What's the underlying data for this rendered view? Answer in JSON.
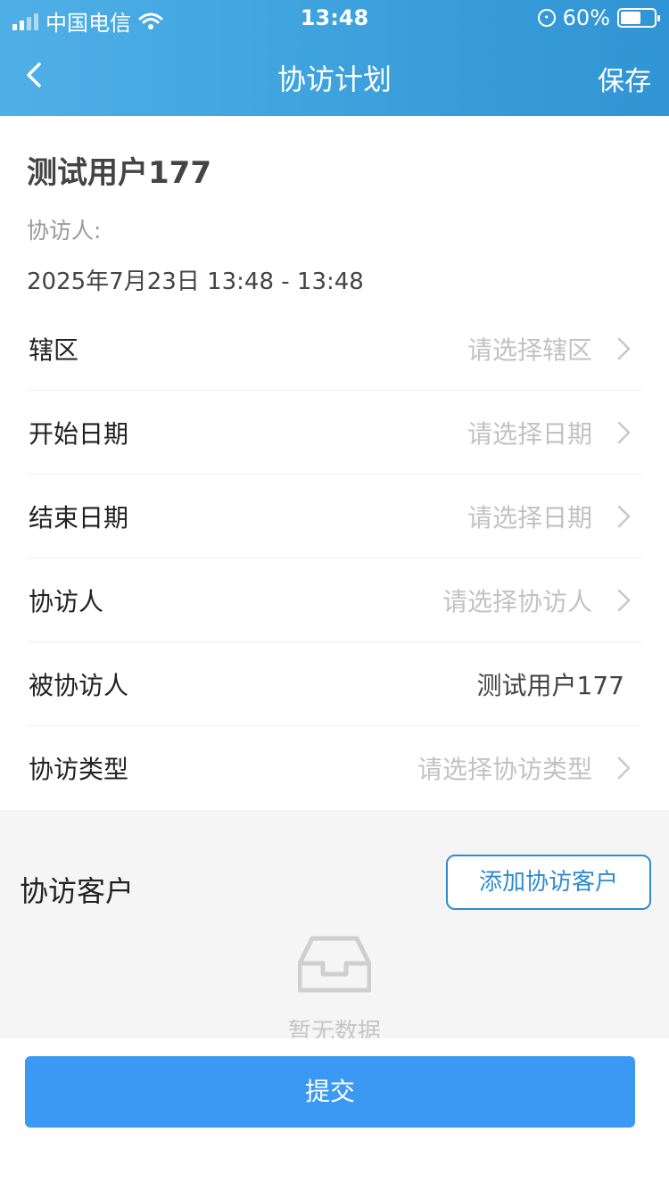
{
  "status_bar": {
    "carrier": "中国电信",
    "time": "13:48",
    "battery": "60%",
    "battery_level": 0.6
  },
  "nav": {
    "title": "协访计划",
    "save_label": "保存",
    "back_icon": "chevron-left-icon"
  },
  "profile": {
    "user_name": "测试用户177",
    "escort_label": "协访人:",
    "time_range": "2025年7月23日 13:48 - 13:48"
  },
  "form": {
    "rows": [
      {
        "label": "辖区",
        "value": "请选择辖区",
        "placeholder": true
      },
      {
        "label": "开始日期",
        "value": "请选择日期",
        "placeholder": true
      },
      {
        "label": "结束日期",
        "value": "请选择日期",
        "placeholder": true
      },
      {
        "label": "协访人",
        "value": "请选择协访人",
        "placeholder": true
      },
      {
        "label": "被协访人",
        "value": "测试用户177",
        "placeholder": false
      },
      {
        "label": "协访类型",
        "value": "请选择协访类型",
        "placeholder": true
      }
    ]
  },
  "customers": {
    "title": "协访客户",
    "add_label": "添加协访客户",
    "empty_text": "暂无数据",
    "empty_icon": "inbox-icon"
  },
  "submit_label": "提交",
  "colors": {
    "header_gradient_start": "#4fb0e6",
    "header_gradient_end": "#3194d4",
    "accent": "#2f8bcf",
    "submit": "#3b99f3",
    "placeholder": "#c2c2c2"
  }
}
